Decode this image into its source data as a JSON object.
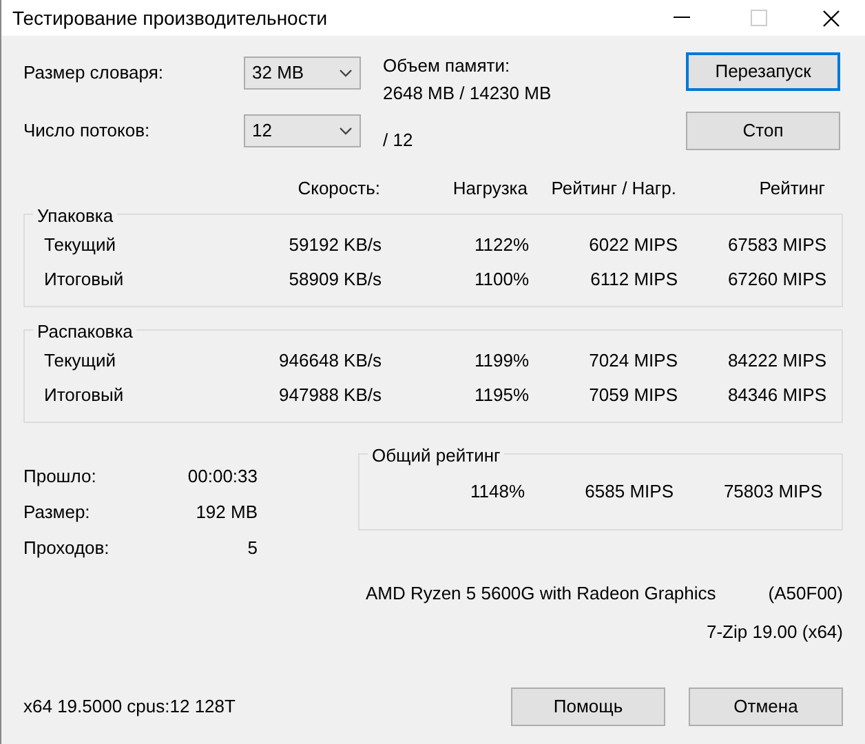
{
  "window": {
    "title": "Тестирование производительности"
  },
  "settings": [
    {
      "label": "Размер словаря:",
      "value": "32 MB"
    },
    {
      "label": "Число потоков:",
      "value": "12"
    }
  ],
  "memory": {
    "label": "Объем памяти:",
    "value": "2648 MB / 14230 MB"
  },
  "threads_total": "/ 12",
  "buttons": [
    {
      "label": "Перезапуск",
      "focused": true
    },
    {
      "label": "Стоп",
      "focused": false
    }
  ],
  "columns": [
    "Скорость:",
    "Нагрузка",
    "Рейтинг / Нагр.",
    "Рейтинг"
  ],
  "groups": [
    {
      "title": "Упаковка",
      "rows": [
        {
          "label": "Текущий",
          "speed": "59192 KB/s",
          "load": "1122%",
          "rating_per_load": "6022 MIPS",
          "rating": "67583 MIPS"
        },
        {
          "label": "Итоговый",
          "speed": "58909 KB/s",
          "load": "1100%",
          "rating_per_load": "6112 MIPS",
          "rating": "67260 MIPS"
        }
      ]
    },
    {
      "title": "Распаковка",
      "rows": [
        {
          "label": "Текущий",
          "speed": "946648 KB/s",
          "load": "1199%",
          "rating_per_load": "7024 MIPS",
          "rating": "84222 MIPS"
        },
        {
          "label": "Итоговый",
          "speed": "947988 KB/s",
          "load": "1195%",
          "rating_per_load": "7059 MIPS",
          "rating": "84346 MIPS"
        }
      ]
    }
  ],
  "stats": [
    {
      "label": "Прошло:",
      "value": "00:00:33"
    },
    {
      "label": "Размер:",
      "value": "192 MB"
    },
    {
      "label": "Проходов:",
      "value": "5"
    }
  ],
  "total": {
    "title": "Общий рейтинг",
    "load": "1148%",
    "rating_per_load": "6585 MIPS",
    "rating": "75803 MIPS"
  },
  "cpu": {
    "name": "AMD Ryzen 5 5600G with Radeon Graphics",
    "id": "(A50F00)"
  },
  "version": "7-Zip 19.00 (x64)",
  "footer": "x64 19.5000 cpus:12 128T",
  "bottom_buttons": [
    "Помощь",
    "Отмена"
  ]
}
